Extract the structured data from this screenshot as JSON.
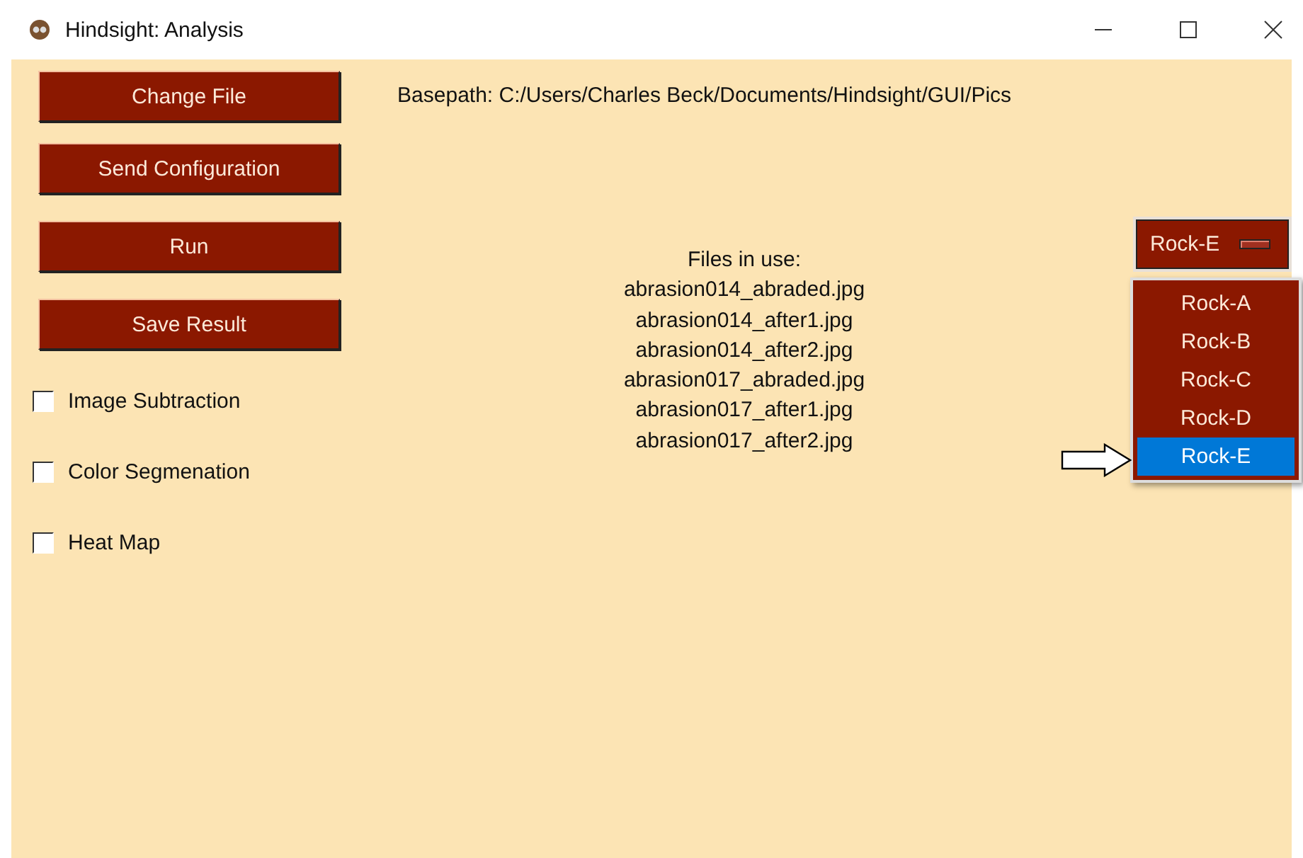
{
  "window": {
    "title": "Hindsight: Analysis"
  },
  "buttons": [
    "Change File",
    "Send Configuration",
    "Run",
    "Save Result"
  ],
  "checkboxes": [
    {
      "label": "Image Subtraction",
      "checked": false
    },
    {
      "label": "Color Segmenation",
      "checked": false
    },
    {
      "label": "Heat Map",
      "checked": false
    }
  ],
  "basepath": "Basepath: C:/Users/Charles Beck/Documents/Hindsight/GUI/Pics",
  "files": {
    "heading": "Files in use:",
    "items": [
      "abrasion014_abraded.jpg",
      "abrasion014_after1.jpg",
      "abrasion014_after2.jpg",
      "abrasion017_abraded.jpg",
      "abrasion017_after1.jpg",
      "abrasion017_after2.jpg"
    ]
  },
  "dropdown": {
    "value": "Rock-E",
    "expanded": true,
    "options": [
      {
        "label": "Rock-A",
        "selected": false
      },
      {
        "label": "Rock-B",
        "selected": false
      },
      {
        "label": "Rock-C",
        "selected": false
      },
      {
        "label": "Rock-D",
        "selected": false
      },
      {
        "label": "Rock-E",
        "selected": true
      }
    ]
  }
}
